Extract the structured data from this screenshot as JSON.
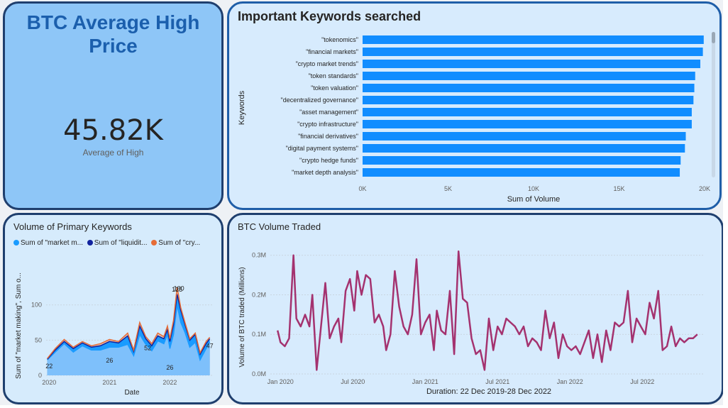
{
  "kpi": {
    "title": "BTC Average High Price",
    "value": "45.82K",
    "label": "Average of High"
  },
  "keywords_card": {
    "title": "Important Keywords searched"
  },
  "primary_card": {
    "title": "Volume of Primary Keywords"
  },
  "volume_card": {
    "title": "BTC Volume Traded"
  },
  "colors": {
    "bar": "#118dff",
    "area_light": "#7ec0fb",
    "area_mid": "#1a9bff",
    "line_navy": "#12239e",
    "line_orange": "#e66c37",
    "volume_line": "#a4326f"
  },
  "chart_data": [
    {
      "type": "bar",
      "orientation": "horizontal",
      "title": "Important Keywords searched",
      "xlabel": "Sum of Volume",
      "ylabel": "Keywords",
      "categories": [
        "\"tokenomics\"",
        "\"financial markets\"",
        "\"crypto market trends\"",
        "\"token standards\"",
        "\"token valuation\"",
        "\"decentralized governance\"",
        "\"asset management\"",
        "\"crypto infrastructure\"",
        "\"financial derivatives\"",
        "\"digital payment systems\"",
        "\"crypto hedge funds\"",
        "\"market depth analysis\""
      ],
      "values": [
        19950,
        19900,
        19750,
        19450,
        19400,
        19350,
        19250,
        19250,
        18900,
        18850,
        18600,
        18550
      ],
      "xlim": [
        0,
        20000
      ],
      "xticks": [
        "0K",
        "5K",
        "10K",
        "15K",
        "20K"
      ]
    },
    {
      "type": "area",
      "title": "Volume of Primary Keywords",
      "xlabel": "Date",
      "ylabel": "Sum of \"market making\", Sum o...",
      "legend": [
        "Sum of \"market m...",
        "Sum of \"liquidit...",
        "Sum of \"cry..."
      ],
      "ylim": [
        0,
        140
      ],
      "yticks": [
        "0",
        "50",
        "100"
      ],
      "xticks": [
        "2020",
        "2021",
        "2022"
      ],
      "data_labels": [
        "22",
        "26",
        "100",
        "52",
        "26",
        "47",
        "125"
      ],
      "x": [
        2019.97,
        2020.1,
        2020.25,
        2020.4,
        2020.55,
        2020.7,
        2020.85,
        2021.0,
        2021.15,
        2021.3,
        2021.4,
        2021.5,
        2021.6,
        2021.7,
        2021.8,
        2021.9,
        2021.96,
        2022.0,
        2022.06,
        2022.12,
        2022.18,
        2022.25,
        2022.33,
        2022.42,
        2022.5,
        2022.6,
        2022.66
      ],
      "series": [
        {
          "name": "Sum of \"market m...",
          "values": [
            22,
            33,
            45,
            33,
            42,
            36,
            36,
            40,
            40,
            44,
            28,
            58,
            44,
            35,
            49,
            45,
            58,
            38,
            58,
            100,
            75,
            61,
            40,
            47,
            22,
            38,
            47
          ]
        },
        {
          "name": "Sum of \"liquidit...",
          "values": [
            23,
            36,
            48,
            38,
            46,
            40,
            42,
            48,
            46,
            56,
            34,
            70,
            52,
            42,
            56,
            52,
            65,
            48,
            72,
            115,
            92,
            72,
            50,
            58,
            30,
            45,
            52
          ]
        },
        {
          "name": "Sum of \"cry...",
          "values": [
            24,
            38,
            51,
            40,
            48,
            42,
            45,
            51,
            48,
            60,
            36,
            75,
            55,
            45,
            60,
            55,
            70,
            52,
            78,
            125,
            96,
            75,
            52,
            60,
            32,
            48,
            54
          ]
        }
      ]
    },
    {
      "type": "line",
      "title": "BTC Volume Traded",
      "xlabel": "Duration: 22 Dec 2019-28 Dec 2022",
      "ylabel": "Volume of BTC traded (Millions)",
      "ylim": [
        0,
        0.33
      ],
      "yticks": [
        "0.0M",
        "0.1M",
        "0.2M",
        "0.3M"
      ],
      "xticks": [
        "Jan 2020",
        "Jul 2020",
        "Jan 2021",
        "Jul 2021",
        "Jan 2022",
        "Jul 2022"
      ],
      "x": [
        2019.98,
        2020.0,
        2020.03,
        2020.06,
        2020.09,
        2020.11,
        2020.14,
        2020.17,
        2020.2,
        2020.22,
        2020.25,
        2020.28,
        2020.31,
        2020.34,
        2020.37,
        2020.4,
        2020.42,
        2020.45,
        2020.48,
        2020.51,
        2020.53,
        2020.56,
        2020.59,
        2020.62,
        2020.65,
        2020.68,
        2020.71,
        2020.73,
        2020.76,
        2020.79,
        2020.82,
        2020.85,
        2020.88,
        2020.91,
        2020.94,
        2020.97,
        2021.0,
        2021.03,
        2021.06,
        2021.08,
        2021.11,
        2021.14,
        2021.17,
        2021.2,
        2021.23,
        2021.26,
        2021.29,
        2021.32,
        2021.35,
        2021.38,
        2021.41,
        2021.44,
        2021.47,
        2021.5,
        2021.53,
        2021.56,
        2021.59,
        2021.62,
        2021.65,
        2021.68,
        2021.71,
        2021.74,
        2021.77,
        2021.8,
        2021.83,
        2021.86,
        2021.89,
        2021.92,
        2021.95,
        2021.98,
        2022.01,
        2022.04,
        2022.07,
        2022.1,
        2022.13,
        2022.16,
        2022.19,
        2022.22,
        2022.25,
        2022.28,
        2022.31,
        2022.34,
        2022.37,
        2022.4,
        2022.43,
        2022.46,
        2022.49,
        2022.52,
        2022.55,
        2022.58,
        2022.61,
        2022.64,
        2022.67,
        2022.7,
        2022.73,
        2022.76,
        2022.79,
        2022.82,
        2022.85,
        2022.88
      ],
      "values": [
        0.11,
        0.08,
        0.07,
        0.09,
        0.3,
        0.14,
        0.12,
        0.15,
        0.12,
        0.2,
        0.01,
        0.12,
        0.23,
        0.09,
        0.12,
        0.14,
        0.08,
        0.21,
        0.24,
        0.16,
        0.26,
        0.2,
        0.25,
        0.24,
        0.13,
        0.15,
        0.12,
        0.06,
        0.1,
        0.26,
        0.17,
        0.12,
        0.1,
        0.15,
        0.29,
        0.1,
        0.13,
        0.15,
        0.06,
        0.16,
        0.11,
        0.1,
        0.21,
        0.05,
        0.31,
        0.19,
        0.18,
        0.09,
        0.05,
        0.06,
        0.01,
        0.14,
        0.06,
        0.12,
        0.1,
        0.14,
        0.13,
        0.12,
        0.1,
        0.12,
        0.07,
        0.09,
        0.08,
        0.06,
        0.16,
        0.09,
        0.13,
        0.04,
        0.1,
        0.07,
        0.06,
        0.07,
        0.05,
        0.08,
        0.11,
        0.04,
        0.1,
        0.03,
        0.11,
        0.06,
        0.13,
        0.12,
        0.13,
        0.21,
        0.08,
        0.14,
        0.12,
        0.1,
        0.18,
        0.14,
        0.21,
        0.06,
        0.07,
        0.12,
        0.07,
        0.09,
        0.08,
        0.09,
        0.09,
        0.1
      ]
    }
  ]
}
